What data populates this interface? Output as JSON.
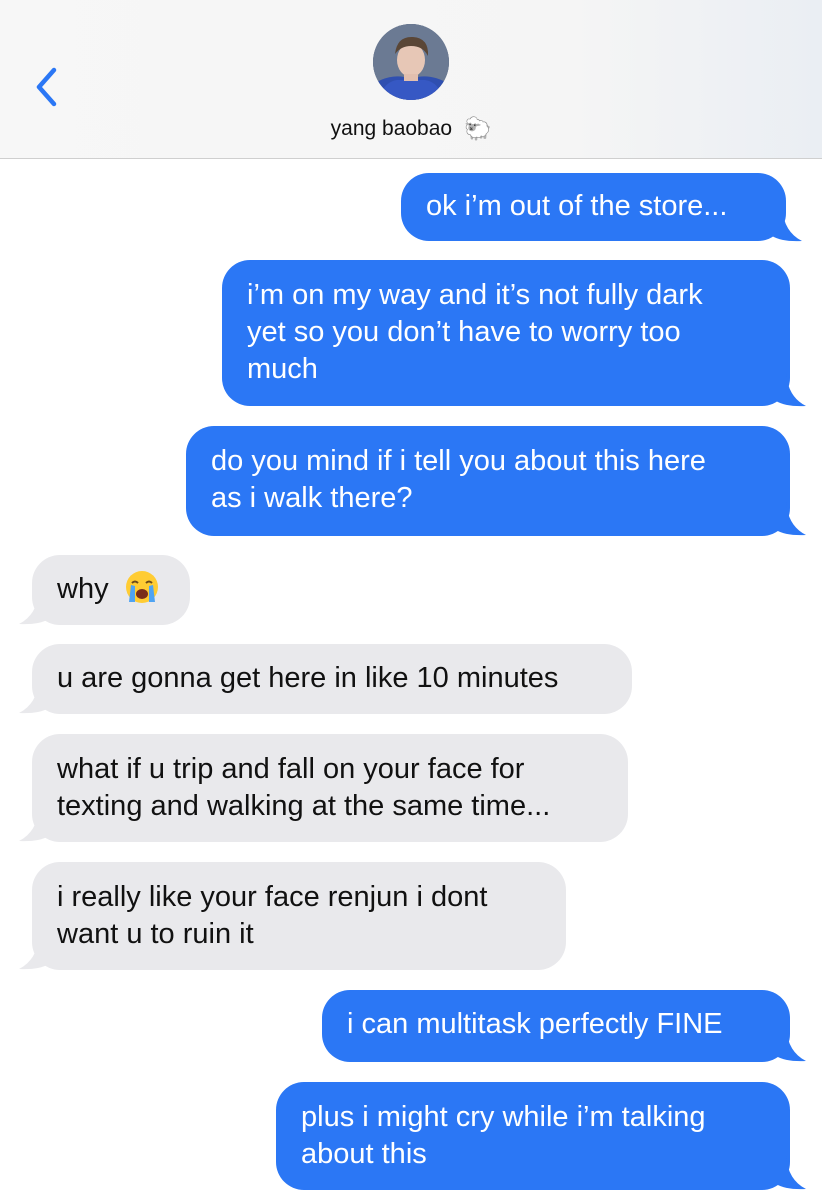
{
  "header": {
    "back_icon": "chevron-left-icon",
    "contact_name": "yang baobao",
    "contact_emoji": "🐑",
    "accent_color": "#2b77f5"
  },
  "messages": [
    {
      "from": "me",
      "text": "ok i’m out of the store..."
    },
    {
      "from": "me",
      "lines": [
        "i’m on my way and it’s not fully dark",
        "yet so you don’t have to worry too",
        "much"
      ]
    },
    {
      "from": "me",
      "lines": [
        "do you mind if i tell you about this here",
        "as i walk there?"
      ]
    },
    {
      "from": "them",
      "text": "why",
      "emoji": "loudly-crying-face-icon"
    },
    {
      "from": "them",
      "text": "u are gonna get here in like 10 minutes"
    },
    {
      "from": "them",
      "lines": [
        "what if u trip and fall on your face for",
        "texting and walking at the same time..."
      ]
    },
    {
      "from": "them",
      "lines": [
        "i really like your face renjun i dont",
        "want u to ruin it"
      ]
    },
    {
      "from": "me",
      "text": "i can multitask perfectly FINE"
    },
    {
      "from": "me",
      "lines": [
        "plus i might cry while i’m talking",
        "about this"
      ]
    }
  ]
}
